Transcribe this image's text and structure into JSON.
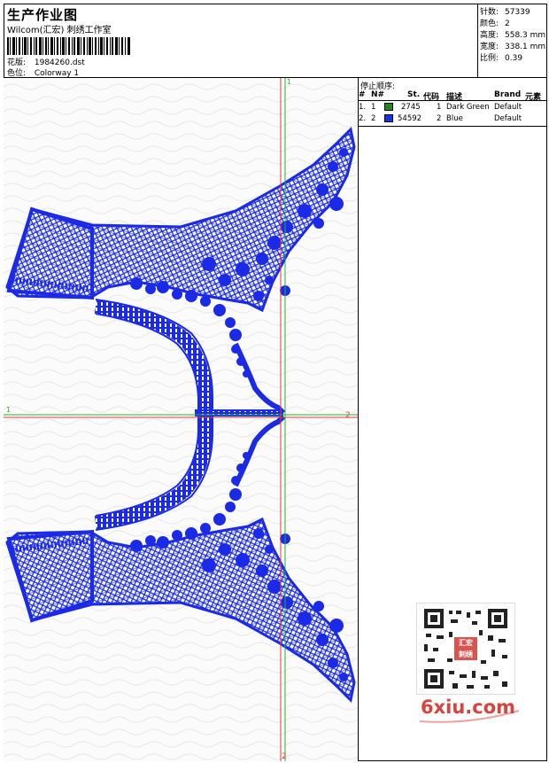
{
  "header": {
    "title": "生产作业图",
    "studio": "Wilcom(汇宏) 刺绣工作室",
    "design_label": "花版:",
    "design_value": "1984260.dst",
    "colorway_label": "色位:",
    "colorway_value": "Colorway 1"
  },
  "specs": [
    {
      "label": "针数:",
      "value": "57339"
    },
    {
      "label": "颜色:",
      "value": "2"
    },
    {
      "label": "高度:",
      "value": "558.3 mm"
    },
    {
      "label": "宽度:",
      "value": "338.1 mm"
    },
    {
      "label": "比例:",
      "value": "0.39"
    }
  ],
  "stop_sequence": {
    "title": "停止顺序:",
    "columns": [
      "#",
      "N#",
      "St.",
      "代码",
      "描述",
      "Brand",
      "元素"
    ],
    "rows": [
      {
        "num": "1.",
        "n": "1",
        "color": "#1a8a1a",
        "st": "2745",
        "code": "1",
        "desc": "Dark Green",
        "brand": "Default"
      },
      {
        "num": "2.",
        "n": "2",
        "color": "#1432e6",
        "st": "54592",
        "code": "2",
        "desc": "Blue",
        "brand": "Default"
      }
    ]
  },
  "canvas": {
    "stitch_color": "#1a2ae6",
    "axis_labels": {
      "v_top": "1",
      "v_bottom": "2",
      "h_left": "1",
      "h_right": "2"
    },
    "axis_colors": {
      "red": "#e23b3b",
      "green": "#22b822"
    }
  },
  "watermark": {
    "stamp": "汇宏 刺绣",
    "site": "6xiu.com"
  }
}
